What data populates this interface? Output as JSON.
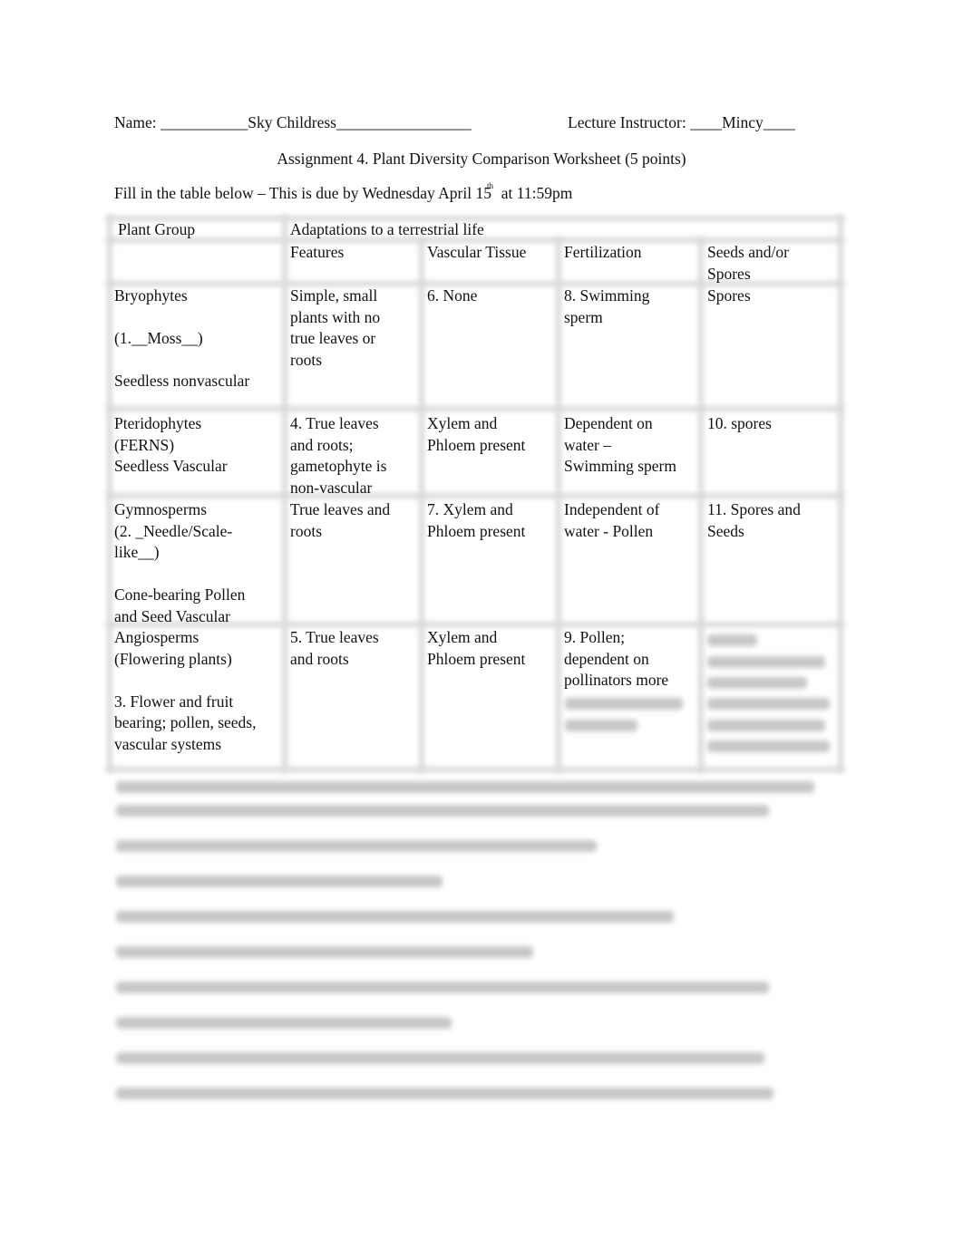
{
  "header": {
    "name_label": "Name: ___________Sky Childress_________________",
    "instructor_label": "Lecture Instructor: ____Mincy____",
    "title": "Assignment 4.  Plant Diversity Comparison Worksheet (5 points)",
    "instructions": "Fill in the table below – This is due by Wednesday April 15",
    "instructions_sup": "th",
    "instructions_tail": "  at 11:59pm"
  },
  "table": {
    "col_plant_group": "Plant Group",
    "group_header": "Adaptations to a terrestrial life",
    "columns": [
      "Features",
      "Vascular Tissue",
      "Fertilization",
      "Seeds and/or\nSpores"
    ],
    "rows": [
      {
        "plant_group": "Bryophytes\n\n(1.__Moss__)\n\nSeedless nonvascular",
        "features": "Simple, small\nplants with no\ntrue leaves or\nroots",
        "vascular_tissue": "6. None",
        "fertilization": "8. Swimming\nsperm",
        "seeds_spores": "Spores"
      },
      {
        "plant_group": "Pteridophytes\n(FERNS)\nSeedless Vascular",
        "features": "4. True leaves\nand roots;\ngametophyte is\nnon-vascular",
        "vascular_tissue": "Xylem and\nPhloem present",
        "fertilization": "Dependent on\nwater –\nSwimming sperm",
        "seeds_spores": "10. spores"
      },
      {
        "plant_group": "Gymnosperms\n(2. _Needle/Scale-\nlike__)\n\nCone-bearing Pollen\nand Seed Vascular",
        "features": "True leaves and\nroots",
        "vascular_tissue": "7. Xylem and\nPhloem present",
        "fertilization": "Independent of\nwater - Pollen",
        "seeds_spores": "11. Spores and\nSeeds"
      },
      {
        "plant_group": "Angiosperms\n(Flowering plants)\n\n3. Flower and fruit\nbearing; pollen, seeds,\nvascular systems",
        "features": "5. True leaves\nand roots",
        "vascular_tissue": "Xylem and\nPhloem present",
        "fertilization": "9. Pollen;\ndependent on\npollinators more",
        "seeds_spores": ""
      }
    ]
  },
  "redacted_note": "Remaining content below the table is blurred and illegible"
}
